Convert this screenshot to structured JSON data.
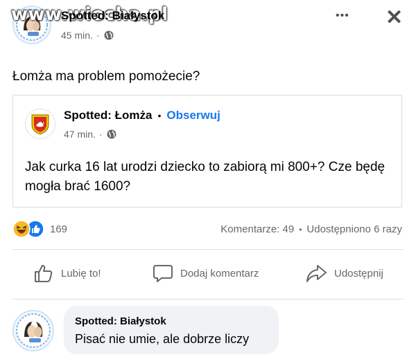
{
  "post": {
    "page_name": "Spotted: Białystok",
    "time": "45 min.",
    "separator": "·",
    "text": "Łomża ma problem pomożecie?",
    "more_label": "•••",
    "close_label": "✕"
  },
  "watermark": "www.wiocha.pl",
  "shared": {
    "page_name": "Spotted: Łomża",
    "dot": "•",
    "follow_label": "Obserwuj",
    "time": "47 min.",
    "separator": "·",
    "text": "Jak curka 16 lat urodzi dziecko to zabiorą mi 800+? Cze będę mogła brać 1600?"
  },
  "stats": {
    "reactions_count": "169",
    "comments": "Komentarze: 49",
    "dot": "•",
    "shares": "Udostępniono 6 razy"
  },
  "actions": {
    "like": "Lubię to!",
    "comment": "Dodaj komentarz",
    "share": "Udostępnij"
  },
  "comment": {
    "author": "Spotted: Białystok",
    "text": "Pisać nie umie, ale dobrze liczy"
  },
  "icons": {
    "globe": "globe-icon",
    "like": "thumbs-up-icon",
    "comment": "comment-bubble-icon",
    "share": "share-arrow-icon",
    "haha": "haha-reaction-icon",
    "like_reaction": "like-reaction-icon"
  },
  "colors": {
    "accent": "#1877f2",
    "gray_text": "#65676b",
    "bubble": "#f0f2f5",
    "reaction_yellow": "#f7b928"
  }
}
